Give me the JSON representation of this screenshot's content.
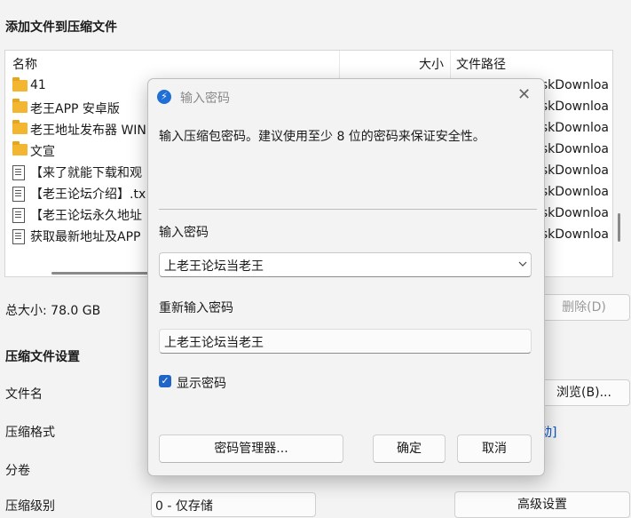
{
  "window": {
    "title": "添加文件到压缩文件"
  },
  "file_list": {
    "columns": {
      "name": "名称",
      "size": "大小",
      "path": "文件路径"
    },
    "rows": [
      {
        "type": "folder",
        "name": "41",
        "path": "iskDownloa"
      },
      {
        "type": "folder",
        "name": "老王APP 安卓版",
        "path": "iskDownloa"
      },
      {
        "type": "folder",
        "name": "老王地址发布器 WIN",
        "path": "iskDownloa"
      },
      {
        "type": "folder",
        "name": "文宣",
        "path": "iskDownloa"
      },
      {
        "type": "file",
        "name": "【来了就能下载和观",
        "path": "iskDownloa"
      },
      {
        "type": "file",
        "name": "【老王论坛介绍】.tx",
        "path": "iskDownloa"
      },
      {
        "type": "file",
        "name": "【老王论坛永久地址",
        "path": "iskDownloa"
      },
      {
        "type": "file",
        "name": "获取最新地址及APP",
        "path": "iskDownloa"
      }
    ]
  },
  "summary": {
    "total_size": "总大小: 78.0 GB",
    "delete_button": "删除(D)"
  },
  "settings": {
    "section_title": "压缩文件设置",
    "file_name_label": "文件名",
    "browse_button": "浏览(B)...",
    "format_label": "压缩格式",
    "format_link_fragment": "动]",
    "split_label": "分卷",
    "level_label": "压缩级别",
    "level_value": "0 - 仅存储",
    "advanced_button": "高级设置"
  },
  "dialog": {
    "title": "输入密码",
    "description": "输入压缩包密码。建议使用至少 8 位的密码来保证安全性。",
    "password_label": "输入密码",
    "password_value": "上老王论坛当老王",
    "confirm_label": "重新输入密码",
    "confirm_value": "上老王论坛当老王",
    "show_password_label": "显示密码",
    "show_password_checked": true,
    "manager_button": "密码管理器...",
    "ok_button": "确定",
    "cancel_button": "取消",
    "close_icon": "close-icon",
    "app_icon": "lightning-icon"
  },
  "colors": {
    "accent": "#1f64c8",
    "link": "#0a55c9",
    "folder": "#f2b630"
  }
}
